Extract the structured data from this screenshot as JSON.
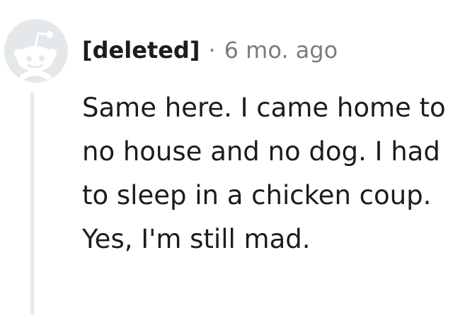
{
  "comment": {
    "author": "[deleted]",
    "separator": "·",
    "timestamp": "6 mo. ago",
    "body": "Same here. I came home to no house and no dog. I had to sleep in a chicken coup. Yes, I'm still mad."
  },
  "icons": {
    "avatar": "deleted-user-avatar-icon"
  },
  "colors": {
    "avatar_background": "#e5e8ea",
    "avatar_foreground": "#ffffff",
    "text_primary": "#1c1c1c",
    "text_meta": "#7c7c7c",
    "thread_line": "#e8e8e8"
  }
}
